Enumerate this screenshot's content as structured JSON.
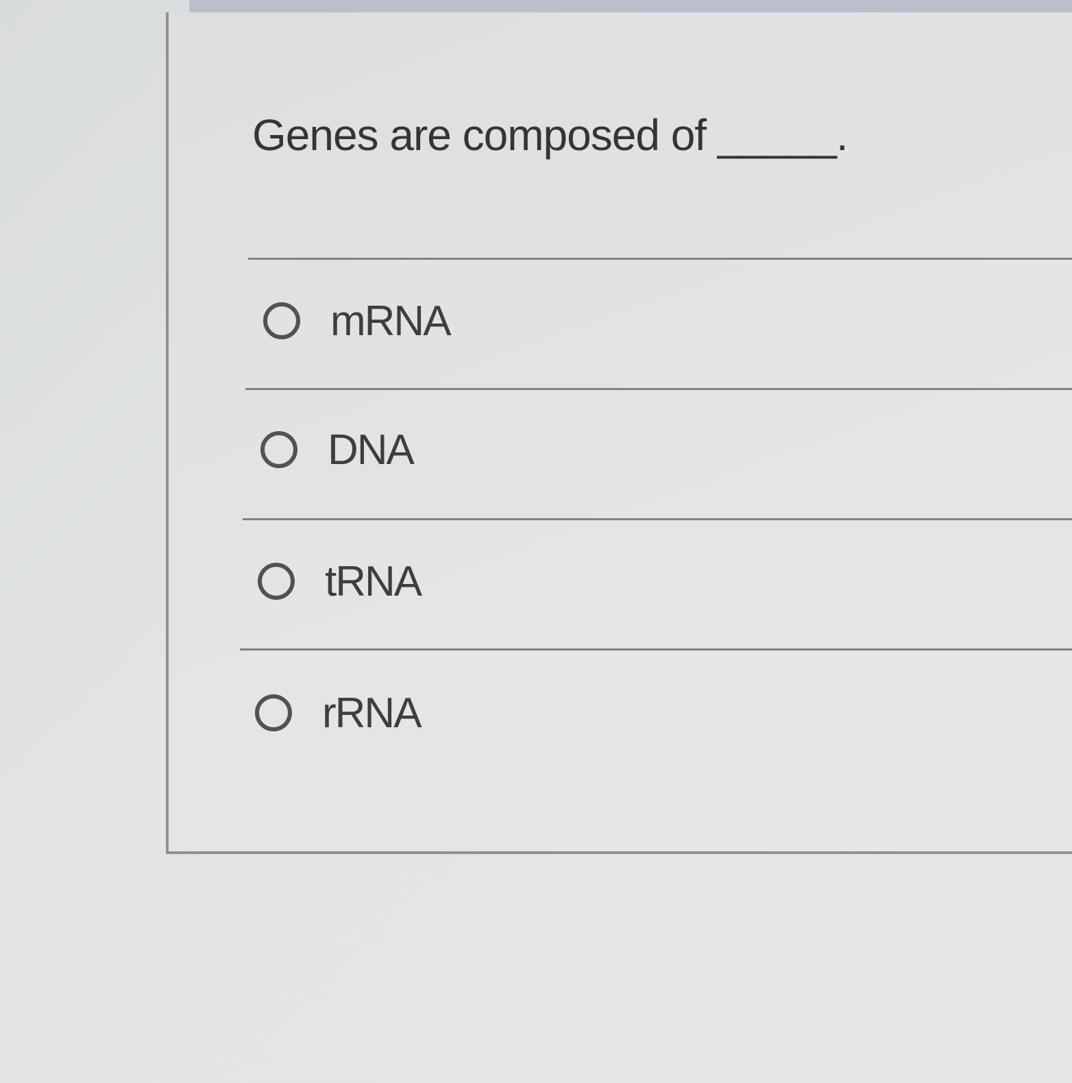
{
  "question": {
    "text": "Genes are composed of _____."
  },
  "options": [
    {
      "label": "mRNA"
    },
    {
      "label": "DNA"
    },
    {
      "label": "tRNA"
    },
    {
      "label": "rRNA"
    }
  ]
}
